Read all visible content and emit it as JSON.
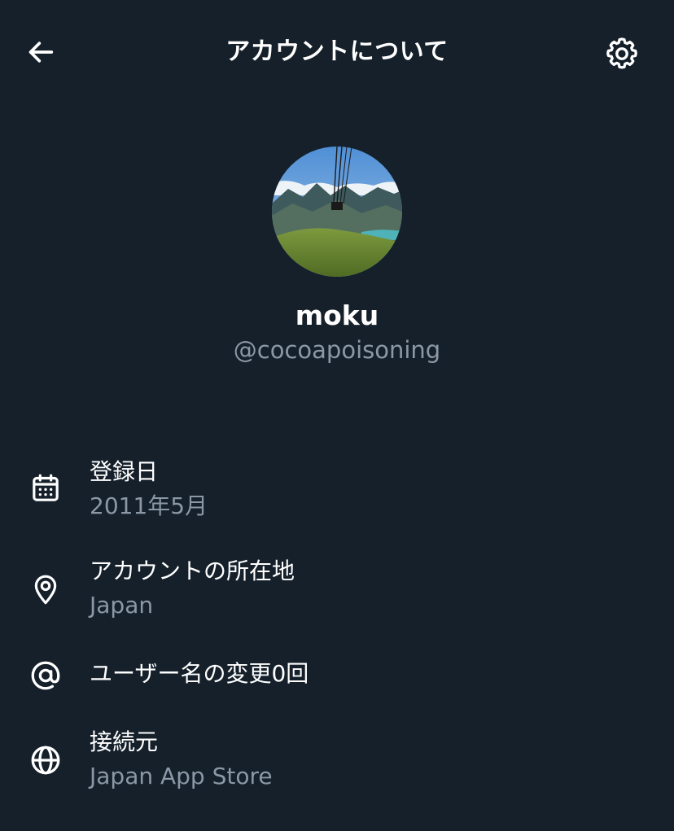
{
  "header": {
    "title": "アカウントについて",
    "back_icon": "arrow-left-icon",
    "settings_icon": "gear-icon"
  },
  "profile": {
    "display_name": "moku",
    "username": "@cocoapoisoning",
    "avatar_description_icon": "avatar"
  },
  "info": {
    "joined": {
      "icon": "calendar-icon",
      "label": "登録日",
      "value": "2011年5月"
    },
    "location": {
      "icon": "location-pin-icon",
      "label": "アカウントの所在地",
      "value": "Japan"
    },
    "username_changes": {
      "icon": "at-sign-icon",
      "label": "ユーザー名の変更0回"
    },
    "connected_via": {
      "icon": "globe-icon",
      "label": "接続元",
      "value": "Japan App Store"
    }
  },
  "colors": {
    "background": "#15202b",
    "primary_text": "#ffffff",
    "secondary_text": "#8b98a5"
  }
}
